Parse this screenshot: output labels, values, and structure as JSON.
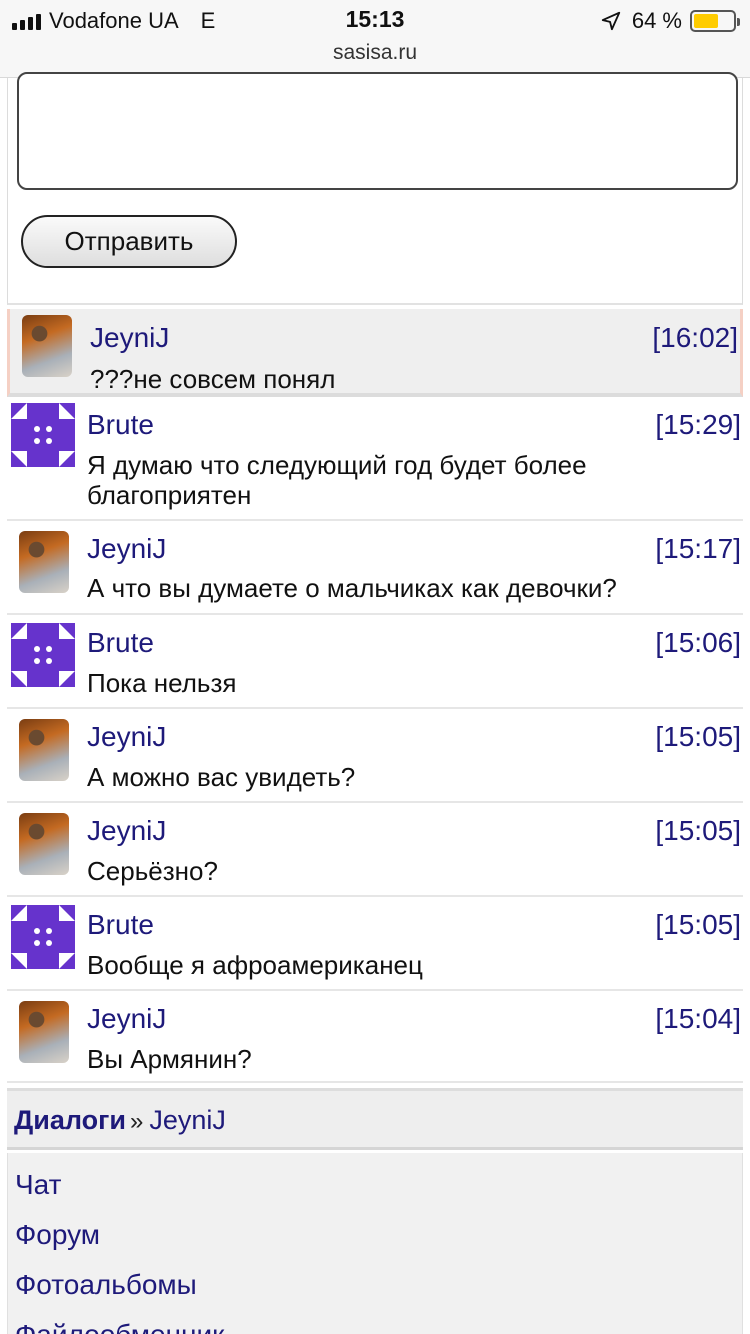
{
  "status_bar": {
    "carrier": "Vodafone UA",
    "network": "E",
    "time": "15:13",
    "url": "sasisa.ru",
    "battery_percent": "64 %",
    "battery_level": 0.64,
    "battery_color": "#ffcc00"
  },
  "form": {
    "textarea_value": "",
    "send_label": "Отправить"
  },
  "messages": [
    {
      "author": "JeyniJ",
      "time": "[16:02]",
      "text": "???не совсем понял",
      "avatar": "photo"
    },
    {
      "author": "Brute",
      "time": "[15:29]",
      "text": "Я думаю что следующий год будет более благоприятен",
      "avatar": "pattern"
    },
    {
      "author": "JeyniJ",
      "time": "[15:17]",
      "text": "А что вы думаете о мальчиках как девочки?",
      "avatar": "photo"
    },
    {
      "author": "Brute",
      "time": "[15:06]",
      "text": "Пока нельзя",
      "avatar": "pattern"
    },
    {
      "author": "JeyniJ",
      "time": "[15:05]",
      "text": "А можно вас увидеть?",
      "avatar": "photo"
    },
    {
      "author": "JeyniJ",
      "time": "[15:05]",
      "text": "Серьёзно?",
      "avatar": "photo"
    },
    {
      "author": "Brute",
      "time": "[15:05]",
      "text": "Вообще я афроамериканец",
      "avatar": "pattern"
    },
    {
      "author": "JeyniJ",
      "time": "[15:04]",
      "text": "Вы Армянин?",
      "avatar": "photo"
    }
  ],
  "breadcrumb": {
    "root": "Диалоги",
    "separator": "»",
    "current": "JeyniJ"
  },
  "nav": {
    "items": [
      {
        "label": "Чат"
      },
      {
        "label": "Форум"
      },
      {
        "label": "Фотоальбомы"
      },
      {
        "label": "Файлообменник"
      }
    ]
  },
  "colors": {
    "link": "#1e1a7a",
    "brute_avatar": "#6633cc"
  }
}
